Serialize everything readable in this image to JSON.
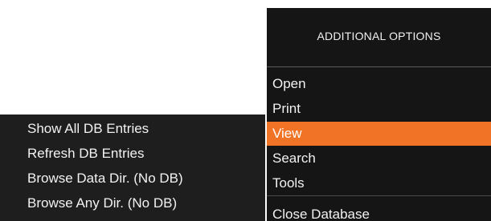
{
  "main_menu": {
    "header": "ADDITIONAL OPTIONS",
    "items": [
      {
        "label": "Open"
      },
      {
        "label": "Print"
      },
      {
        "label": "View",
        "active": true
      },
      {
        "label": "Search"
      },
      {
        "label": "Tools"
      },
      {
        "label": "Close Database"
      }
    ]
  },
  "sub_menu": {
    "items": [
      {
        "label": "Show All DB Entries"
      },
      {
        "label": "Refresh DB Entries"
      },
      {
        "label": "Browse Data Dir. (No DB)"
      },
      {
        "label": "Browse Any Dir. (No DB)"
      }
    ]
  },
  "colors": {
    "menu_bg": "#151515",
    "submenu_bg": "#1e1e1e",
    "active_bg": "#f07326",
    "text": "#f2f2f2"
  }
}
